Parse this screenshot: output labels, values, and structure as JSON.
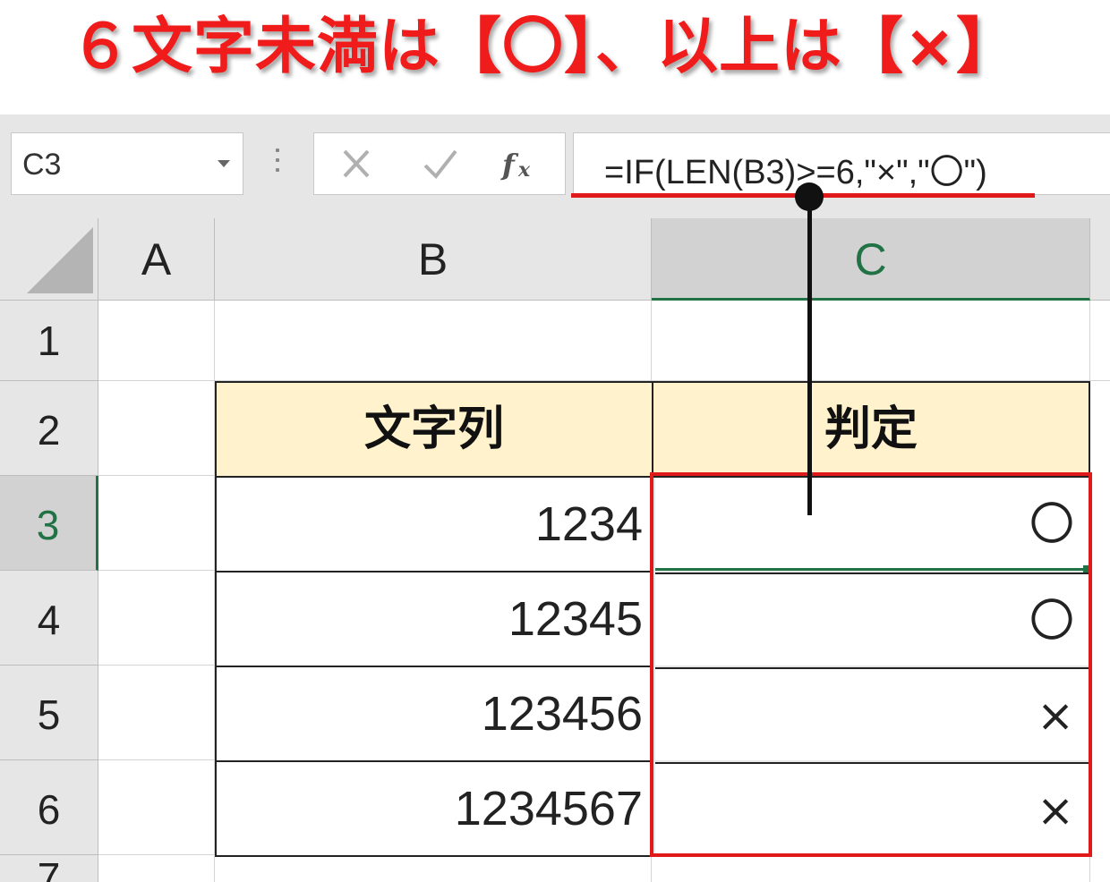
{
  "headline": "６文字未満は【〇】、以上は【×】",
  "formula_bar": {
    "name_box": "C3",
    "cancel_icon": "cross-icon",
    "enter_icon": "check-icon",
    "function_icon": "fx-icon",
    "formula": "=IF(LEN(B3)>=6,\"×\",\"〇\")"
  },
  "columns": [
    "A",
    "B",
    "C"
  ],
  "rows": [
    "1",
    "2",
    "3",
    "4",
    "5",
    "6",
    "7"
  ],
  "active_cell": {
    "column": "C",
    "row": "3"
  },
  "table": {
    "headers": [
      "文字列",
      "判定"
    ],
    "rows": [
      {
        "string": "1234",
        "judgement": "〇"
      },
      {
        "string": "12345",
        "judgement": "〇"
      },
      {
        "string": "123456",
        "judgement": "×"
      },
      {
        "string": "1234567",
        "judgement": "×"
      }
    ]
  },
  "colors": {
    "headline": "#f01c1c",
    "highlight": "#e01a1a",
    "header_fill": "#fff2cc",
    "excel_green": "#217346"
  }
}
